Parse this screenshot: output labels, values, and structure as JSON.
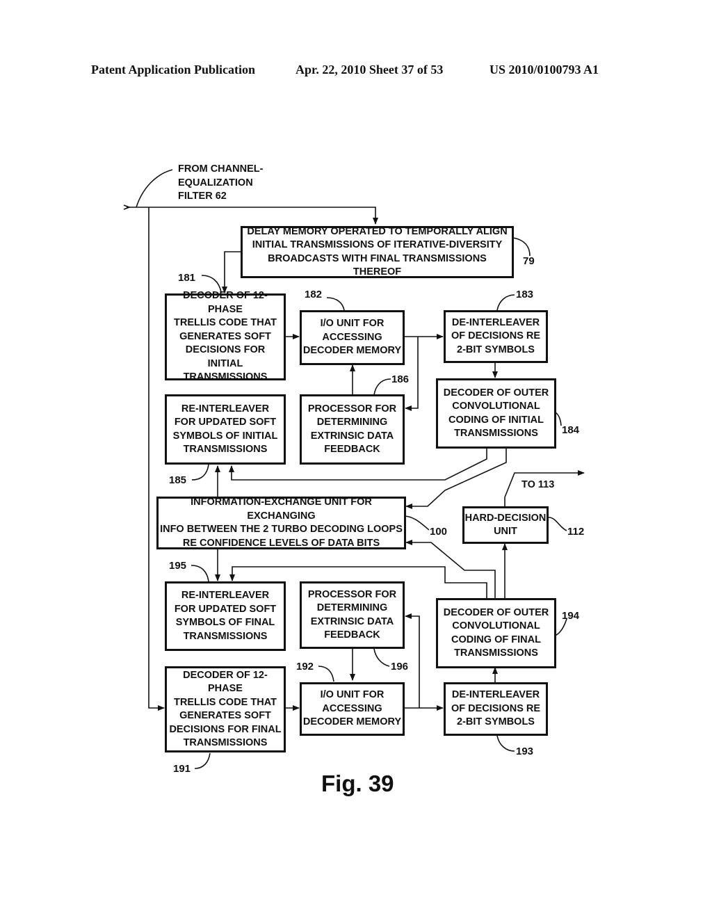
{
  "header": {
    "publication": "Patent Application Publication",
    "date_sheet": "Apr. 22, 2010  Sheet 37 of 53",
    "patent_number": "US 2010/0100793 A1"
  },
  "input_label": "FROM CHANNEL-\nEQUALIZATION\nFILTER 62",
  "output_label": "TO 113",
  "blocks": {
    "delay_memory": {
      "text": "DELAY MEMORY OPERATED TO TEMPORALLY ALIGN\nINITIAL TRANSMISSIONS OF ITERATIVE-DIVERSITY\nBROADCASTS WITH FINAL TRANSMISSIONS THEREOF",
      "ref": "79"
    },
    "decoder_181": {
      "text": "DECODER OF 12-PHASE\nTRELLIS CODE THAT\nGENERATES SOFT\nDECISIONS FOR INITIAL\nTRANSMISSIONS",
      "ref": "181"
    },
    "io_182": {
      "text": "I/O UNIT FOR\nACCESSING\nDECODER MEMORY",
      "ref": "182"
    },
    "deinterleaver_183": {
      "text": "DE-INTERLEAVER\nOF DECISIONS RE\n2-BIT SYMBOLS",
      "ref": "183"
    },
    "outer_decoder_184": {
      "text": "DECODER OF OUTER\nCONVOLUTIONAL\nCODING OF INITIAL\nTRANSMISSIONS",
      "ref": "184"
    },
    "reinterleaver_185": {
      "text": "RE-INTERLEAVER\nFOR UPDATED SOFT\nSYMBOLS OF INITIAL\nTRANSMISSIONS",
      "ref": "185"
    },
    "processor_186": {
      "text": "PROCESSOR FOR\nDETERMINING\nEXTRINSIC DATA\nFEEDBACK",
      "ref": "186"
    },
    "info_exchange_100": {
      "text": "INFORMATION-EXCHANGE UNIT FOR EXCHANGING\nINFO BETWEEN THE 2 TURBO DECODING LOOPS\nRE CONFIDENCE LEVELS OF DATA BITS",
      "ref": "100"
    },
    "hard_decision_112": {
      "text": "HARD-DECISION\nUNIT",
      "ref": "112"
    },
    "reinterleaver_195": {
      "text": "RE-INTERLEAVER\nFOR UPDATED SOFT\nSYMBOLS OF FINAL\nTRANSMISSIONS",
      "ref": "195"
    },
    "processor_196": {
      "text": "PROCESSOR FOR\nDETERMINING\nEXTRINSIC DATA\nFEEDBACK",
      "ref": "196"
    },
    "outer_decoder_194": {
      "text": "DECODER OF OUTER\nCONVOLUTIONAL\nCODING OF FINAL\nTRANSMISSIONS",
      "ref": "194"
    },
    "decoder_191": {
      "text": "DECODER OF 12-PHASE\nTRELLIS CODE THAT\nGENERATES SOFT\nDECISIONS FOR FINAL\nTRANSMISSIONS",
      "ref": "191"
    },
    "io_192": {
      "text": "I/O UNIT FOR\nACCESSING\nDECODER MEMORY",
      "ref": "192"
    },
    "deinterleaver_193": {
      "text": "DE-INTERLEAVER\nOF DECISIONS RE\n2-BIT SYMBOLS",
      "ref": "193"
    }
  },
  "figure_caption": "Fig. 39"
}
